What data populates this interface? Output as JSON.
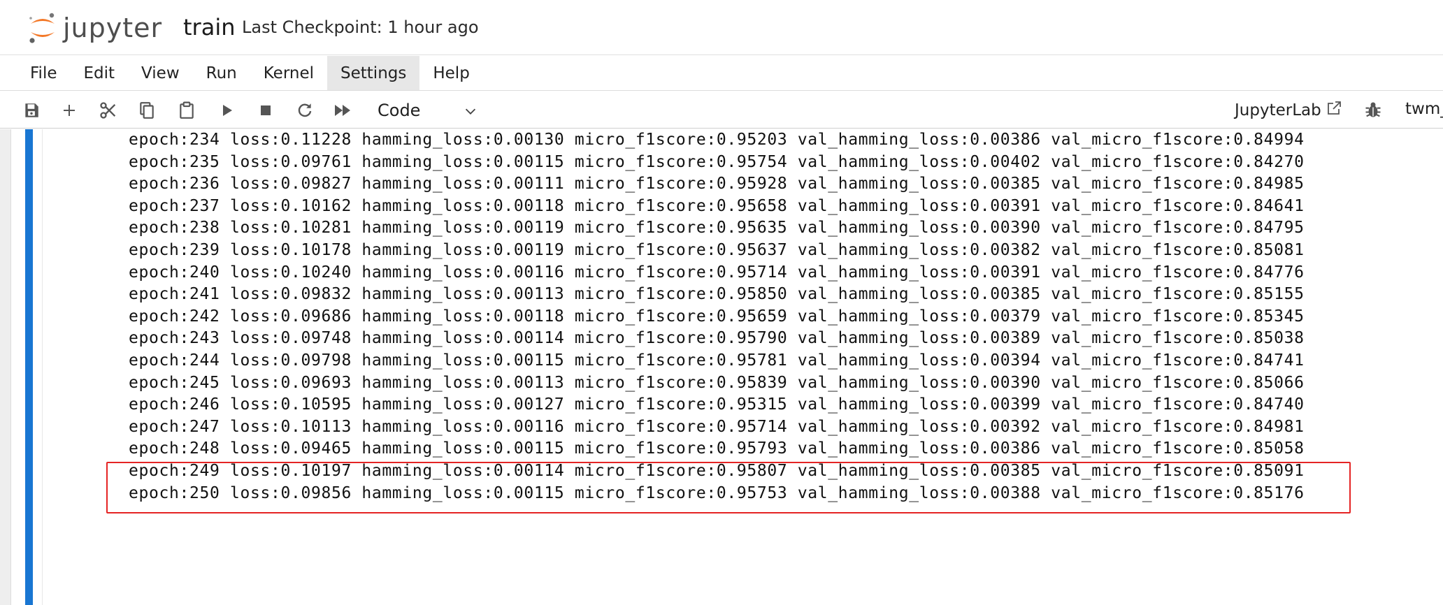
{
  "header": {
    "logo_text": "jupyter",
    "notebook_title": "train",
    "checkpoint": "Last Checkpoint: 1 hour ago"
  },
  "menu": {
    "items": [
      {
        "label": "File"
      },
      {
        "label": "Edit"
      },
      {
        "label": "View"
      },
      {
        "label": "Run"
      },
      {
        "label": "Kernel"
      },
      {
        "label": "Settings",
        "active": true
      },
      {
        "label": "Help"
      }
    ]
  },
  "toolbar": {
    "icons": [
      "save-icon",
      "add-cell-icon",
      "cut-icon",
      "copy-icon",
      "paste-icon",
      "run-icon",
      "stop-icon",
      "restart-icon",
      "fast-forward-icon"
    ],
    "cell_type": "Code",
    "jupyterlab_label": "JupyterLab",
    "kernel_name": "twm_"
  },
  "output": {
    "lines": [
      "epoch:234 loss:0.11228 hamming_loss:0.00130 micro_f1score:0.95203 val_hamming_loss:0.00386 val_micro_f1score:0.84994",
      "epoch:235 loss:0.09761 hamming_loss:0.00115 micro_f1score:0.95754 val_hamming_loss:0.00402 val_micro_f1score:0.84270",
      "epoch:236 loss:0.09827 hamming_loss:0.00111 micro_f1score:0.95928 val_hamming_loss:0.00385 val_micro_f1score:0.84985",
      "epoch:237 loss:0.10162 hamming_loss:0.00118 micro_f1score:0.95658 val_hamming_loss:0.00391 val_micro_f1score:0.84641",
      "epoch:238 loss:0.10281 hamming_loss:0.00119 micro_f1score:0.95635 val_hamming_loss:0.00390 val_micro_f1score:0.84795",
      "epoch:239 loss:0.10178 hamming_loss:0.00119 micro_f1score:0.95637 val_hamming_loss:0.00382 val_micro_f1score:0.85081",
      "epoch:240 loss:0.10240 hamming_loss:0.00116 micro_f1score:0.95714 val_hamming_loss:0.00391 val_micro_f1score:0.84776",
      "epoch:241 loss:0.09832 hamming_loss:0.00113 micro_f1score:0.95850 val_hamming_loss:0.00385 val_micro_f1score:0.85155",
      "epoch:242 loss:0.09686 hamming_loss:0.00118 micro_f1score:0.95659 val_hamming_loss:0.00379 val_micro_f1score:0.85345",
      "epoch:243 loss:0.09748 hamming_loss:0.00114 micro_f1score:0.95790 val_hamming_loss:0.00389 val_micro_f1score:0.85038",
      "epoch:244 loss:0.09798 hamming_loss:0.00115 micro_f1score:0.95781 val_hamming_loss:0.00394 val_micro_f1score:0.84741",
      "epoch:245 loss:0.09693 hamming_loss:0.00113 micro_f1score:0.95839 val_hamming_loss:0.00390 val_micro_f1score:0.85066",
      "epoch:246 loss:0.10595 hamming_loss:0.00127 micro_f1score:0.95315 val_hamming_loss:0.00399 val_micro_f1score:0.84740",
      "epoch:247 loss:0.10113 hamming_loss:0.00116 micro_f1score:0.95714 val_hamming_loss:0.00392 val_micro_f1score:0.84981",
      "epoch:248 loss:0.09465 hamming_loss:0.00115 micro_f1score:0.95793 val_hamming_loss:0.00386 val_micro_f1score:0.85058",
      "epoch:249 loss:0.10197 hamming_loss:0.00114 micro_f1score:0.95807 val_hamming_loss:0.00385 val_micro_f1score:0.85091",
      "epoch:250 loss:0.09856 hamming_loss:0.00115 micro_f1score:0.95753 val_hamming_loss:0.00388 val_micro_f1score:0.85176"
    ]
  },
  "colors": {
    "cell_bar": "#1976d2",
    "highlight": "#e52424",
    "logo_orange": "#f37726"
  }
}
